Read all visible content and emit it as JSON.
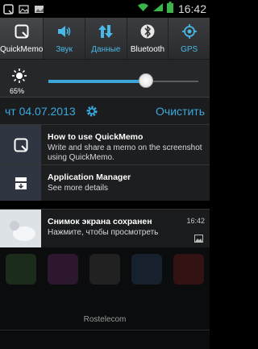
{
  "status_bar": {
    "time": "16:42",
    "notification_icons": [
      "quickmemo-icon",
      "gallery-icon",
      "image-icon"
    ],
    "system_icons": [
      "wifi-icon",
      "signal-icon",
      "battery-icon"
    ]
  },
  "quick_settings": [
    {
      "label": "QuickMemo",
      "icon": "quickmemo-icon",
      "active": true
    },
    {
      "label": "Звук",
      "icon": "volume-icon",
      "active": false
    },
    {
      "label": "Данные",
      "icon": "data-arrows-icon",
      "active": false
    },
    {
      "label": "Bluetooth",
      "icon": "bluetooth-icon",
      "active": false
    },
    {
      "label": "GPS",
      "icon": "gps-icon",
      "active": false
    }
  ],
  "brightness": {
    "label": "65%",
    "value": 0.65
  },
  "date_row": {
    "date": "чт 04.07.2013",
    "clear_label": "Очистить"
  },
  "notifications": [
    {
      "title": "How to use QuickMemo",
      "text": "Write and share a memo on the screenshot using QuickMemo.",
      "icon": "quickmemo-icon"
    },
    {
      "title": "Application Manager",
      "text": "See more details",
      "icon": "app-manager-icon"
    },
    {
      "title": "Снимок экрана сохранен",
      "text": "Нажмите, чтобы просмотреть",
      "time": "16:42",
      "icon": "screenshot-thumbnail"
    }
  ],
  "home": {
    "carrier": "Rostelecom"
  },
  "colors": {
    "accent": "#3aa9e0",
    "panel": "#1d1e20"
  }
}
